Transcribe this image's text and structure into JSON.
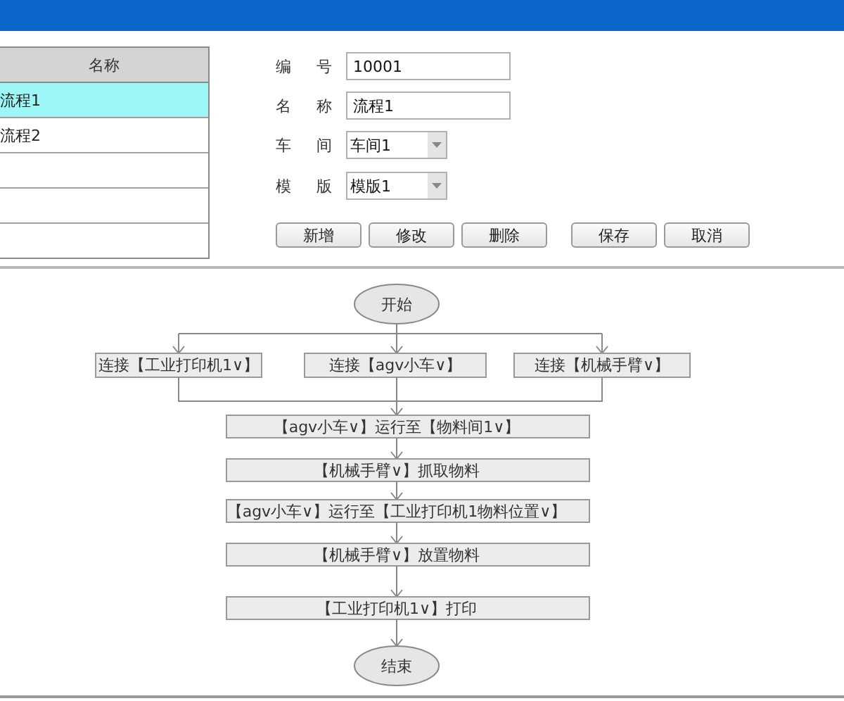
{
  "table": {
    "header": "名称",
    "rows": [
      {
        "name": "流程1",
        "selected": true
      },
      {
        "name": "流程2",
        "selected": false
      }
    ]
  },
  "form": {
    "fields": [
      {
        "label": "编号",
        "kind": "text",
        "value": "10001"
      },
      {
        "label": "名称",
        "kind": "text",
        "value": "流程1"
      },
      {
        "label": "车间",
        "kind": "select",
        "value": "车间1"
      },
      {
        "label": "模版",
        "kind": "select",
        "value": "模版1"
      }
    ],
    "buttons": [
      "新增",
      "修改",
      "删除",
      "保存",
      "取消"
    ]
  },
  "flowchart": {
    "start": "开始",
    "parallel": [
      "连接【工业打印机1∨】",
      "连接【agv小车∨】",
      "连接【机械手臂∨】"
    ],
    "steps": [
      "【agv小车∨】运行至【物料间1∨】",
      "【机械手臂∨】抓取物料",
      "【agv小车∨】运行至【工业打印机1物料位置∨】",
      "【机械手臂∨】放置物料",
      "【工业打印机1∨】打印"
    ],
    "end": "结束"
  }
}
